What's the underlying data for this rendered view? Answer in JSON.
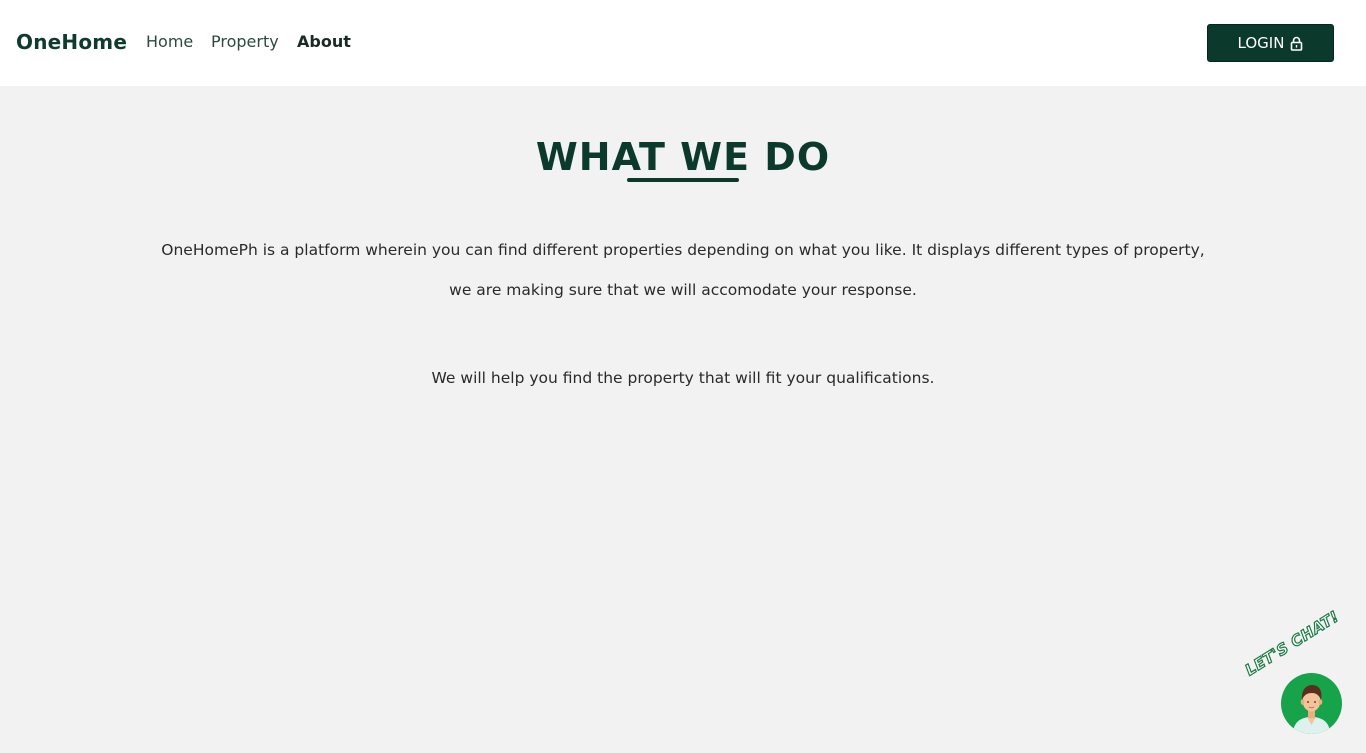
{
  "nav": {
    "brand": "OneHome",
    "links": [
      "Home",
      "Property",
      "About"
    ],
    "active": "About",
    "login_label": "LOGIN",
    "login_icon": "lock-icon"
  },
  "main": {
    "heading": "WHAT WE DO",
    "paragraph1": "OneHomePh is a platform wherein you can find different properties depending on what you like. It displays different types of property, we are making sure that we will accomodate your response.",
    "paragraph2": "We will help you find the property that will fit your qualifications."
  },
  "chat": {
    "label": "LET'S CHAT!",
    "avatar_icon": "support-agent-avatar"
  },
  "colors": {
    "brand": "#0b3a2c",
    "background": "#f2f2f2",
    "navbar": "#ffffff",
    "chat_green": "#17a34a"
  }
}
